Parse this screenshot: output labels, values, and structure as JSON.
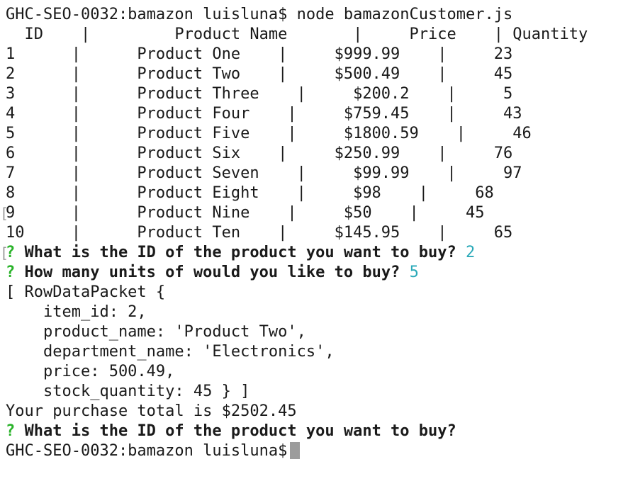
{
  "terminal": {
    "command_prompt": "GHC-SEO-0032:bamazon luisluna$ node bamazonCustomer.js",
    "table_header": "  ID    |         Product Name       |     Price    | Quantity",
    "table_rows": [
      "1      |      Product One    |     $999.99    |     23",
      "2      |      Product Two    |     $500.49    |     45",
      "3      |      Product Three    |     $200.2    |     5",
      "4      |      Product Four    |     $759.45    |     43",
      "5      |      Product Five    |     $1800.59    |     46",
      "6      |      Product Six    |     $250.99    |     76",
      "7      |      Product Seven    |     $99.99    |     97",
      "8      |      Product Eight    |     $98    |     68",
      "9      |      Product Nine    |     $50    |     45",
      "10     |      Product Ten    |     $145.95    |     65"
    ],
    "prompts": [
      {
        "mark": "?",
        "question": "What is the ID of the product you want to buy?",
        "answer": "2"
      },
      {
        "mark": "?",
        "question": "How many units of would you like to buy?",
        "answer": "5"
      },
      {
        "mark": "?",
        "question": "What is the ID of the product you want to buy?",
        "answer": ""
      }
    ],
    "result_lines": [
      "[ RowDataPacket {",
      "    item_id: 2,",
      "    product_name: 'Product Two',",
      "    department_name: 'Electronics',",
      "    price: 500.49,",
      "    stock_quantity: 45 } ]"
    ],
    "purchase_total": "Your purchase total is $2502.45",
    "final_prompt": "GHC-SEO-0032:bamazon luisluna$"
  }
}
